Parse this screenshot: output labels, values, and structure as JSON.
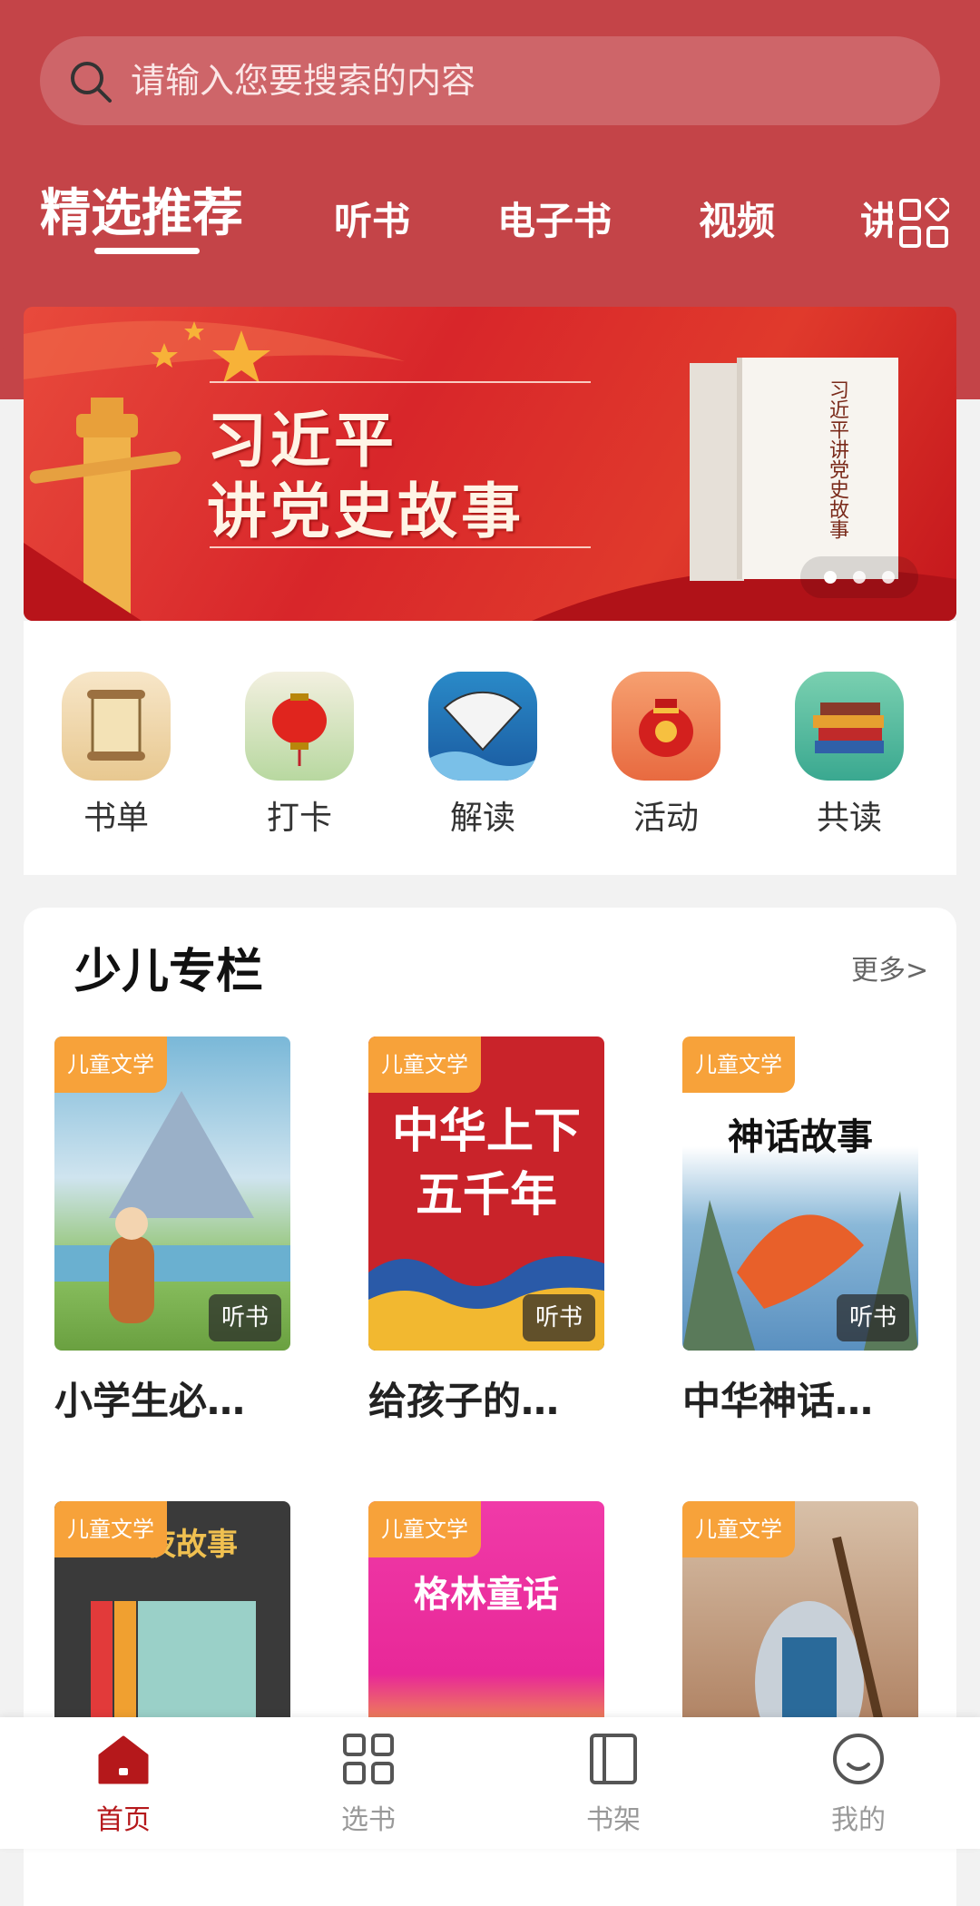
{
  "search": {
    "placeholder": "请输入您要搜索的内容"
  },
  "tabs": [
    {
      "label": "精选推荐",
      "active": true
    },
    {
      "label": "听书"
    },
    {
      "label": "电子书"
    },
    {
      "label": "视频"
    },
    {
      "label": "讲"
    }
  ],
  "banner": {
    "title_line1": "习近平",
    "title_line2": "讲党史故事",
    "book_spine_text": "习近平讲党史故事",
    "slide_count": 3,
    "active_slide": 1
  },
  "quick_entries": [
    {
      "label": "书单",
      "icon": "scroll-icon"
    },
    {
      "label": "打卡",
      "icon": "lantern-icon"
    },
    {
      "label": "解读",
      "icon": "fan-icon"
    },
    {
      "label": "活动",
      "icon": "lucky-bag-icon"
    },
    {
      "label": "共读",
      "icon": "books-icon"
    }
  ],
  "kids_section": {
    "title": "少儿专栏",
    "more": "更多>",
    "books": [
      {
        "tag": "儿童文学",
        "badge": "听书",
        "title": "小学生必…"
      },
      {
        "tag": "儿童文学",
        "badge": "听书",
        "title": "给孩子的…",
        "cover_text": "中华上下五千年"
      },
      {
        "tag": "儿童文学",
        "badge": "听书",
        "title": "中华神话…",
        "cover_text": "神话故事"
      },
      {
        "tag": "儿童文学",
        "cover_text": "夜故事"
      },
      {
        "tag": "儿童文学",
        "cover_text": "格林童话"
      },
      {
        "tag": "儿童文学"
      }
    ]
  },
  "bottom_nav": [
    {
      "label": "首页",
      "icon": "home-icon",
      "active": true
    },
    {
      "label": "选书",
      "icon": "grid-icon"
    },
    {
      "label": "书架",
      "icon": "bookshelf-icon"
    },
    {
      "label": "我的",
      "icon": "profile-icon"
    }
  ],
  "colors": {
    "header_bg": "#c44448",
    "tag_bg": "#f7a23a",
    "accent": "#b5181b"
  }
}
